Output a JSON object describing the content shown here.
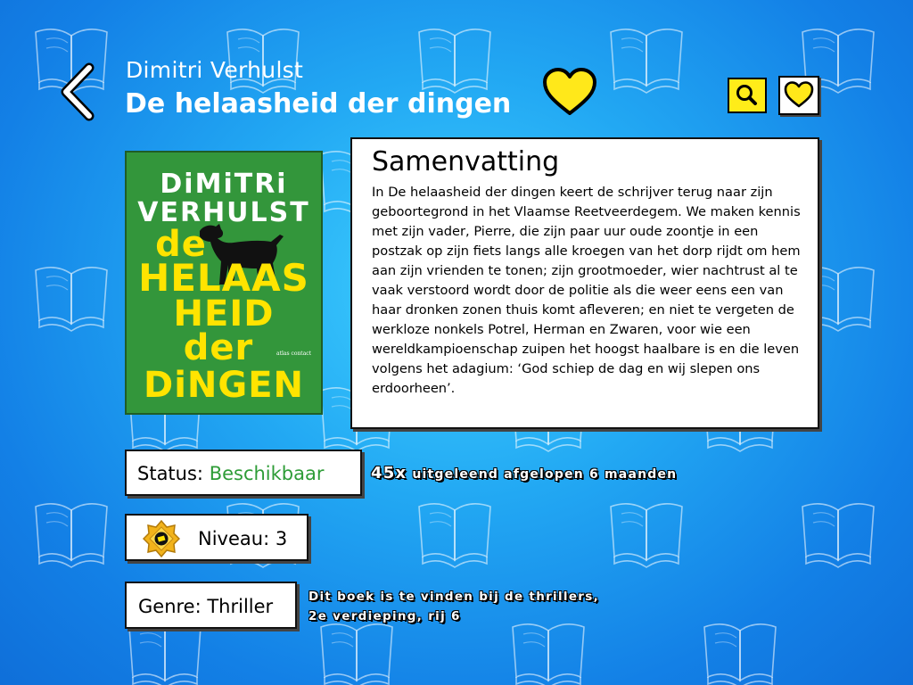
{
  "header": {
    "author": "Dimitri Verhulst",
    "title": "De helaasheid der dingen"
  },
  "toolbar": {
    "back_icon": "chevron-left-icon",
    "favorite_icon": "heart-icon",
    "search_icon": "search-icon",
    "favorites_list_icon": "heart-outline-icon"
  },
  "cover": {
    "author_line1": "DiMiTRi",
    "author_line2": "VERHULST",
    "title_line1": "de",
    "title_line2": "HELAAS",
    "title_line3": "HEID",
    "title_line4": "der",
    "title_line5": "DiNGEN",
    "publisher": "atlas contact"
  },
  "summary": {
    "heading": "Samenvatting",
    "text": "In De helaasheid der dingen keert de schrijver terug naar zijn geboortegrond in het Vlaamse Reetveerdegem. We maken kennis met zijn vader, Pierre, die zijn paar uur oude zoontje in een postzak op zijn fiets langs alle kroegen van het dorp rijdt om hem aan zijn vrienden te tonen; zijn grootmoeder, wier nachtrust al te vaak verstoord wordt door de politie als die weer eens een van haar dronken zonen thuis komt afleveren; en niet te vergeten de werkloze nonkels Potrel, Herman en Zwaren, voor wie een wereldkampioenschap zuipen het hoogst haalbare is en die leven volgens het adagium: ‘God schiep de dag en wij slepen ons erdoorheen’."
  },
  "status": {
    "label": "Status:",
    "value": "Beschikbaar",
    "value_color": "#2e9c37"
  },
  "loans": {
    "count": "45x",
    "text": "uitgeleend afgelopen 6 maanden"
  },
  "level": {
    "label": "Niveau: 3",
    "badge_icon": "level-badge-icon"
  },
  "genre": {
    "label": "Genre: Thriller",
    "location_line1": "Dit boek is te vinden bij de thrillers,",
    "location_line2": "2e verdieping, rij 6"
  },
  "colors": {
    "accent_yellow": "#ffec19",
    "background_blue": "#22a8f3",
    "cover_green": "#33963b",
    "cover_title_yellow": "#ffe400"
  }
}
